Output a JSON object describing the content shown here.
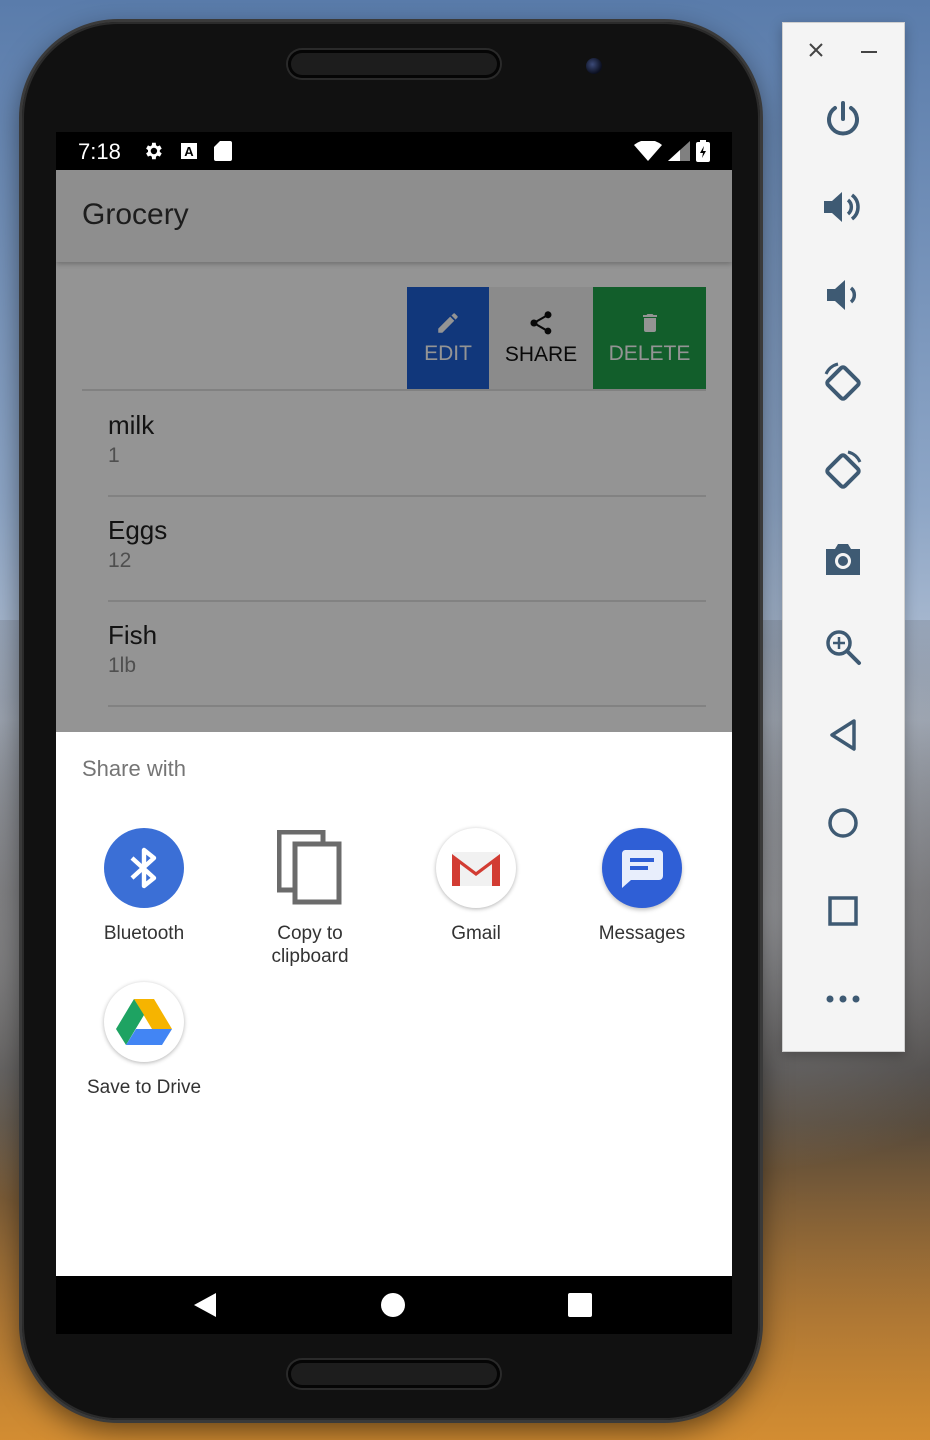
{
  "status_bar": {
    "time": "7:18"
  },
  "app": {
    "title": "Grocery",
    "swipe_actions": {
      "edit": "EDIT",
      "share": "SHARE",
      "delete": "DELETE"
    },
    "items": [
      {
        "name": "milk",
        "qty": "1"
      },
      {
        "name": "Eggs",
        "qty": "12"
      },
      {
        "name": "Fish",
        "qty": "1lb"
      }
    ]
  },
  "share_sheet": {
    "title": "Share with",
    "targets": [
      {
        "label": "Bluetooth",
        "icon": "bluetooth-icon"
      },
      {
        "label": "Copy to\nclipboard",
        "icon": "copy-icon"
      },
      {
        "label": "Gmail",
        "icon": "gmail-icon"
      },
      {
        "label": "Messages",
        "icon": "messages-icon"
      },
      {
        "label": "Save to Drive",
        "icon": "drive-icon"
      }
    ]
  },
  "emulator_controls": [
    "power-icon",
    "volume-up-icon",
    "volume-down-icon",
    "rotate-left-icon",
    "rotate-right-icon",
    "camera-icon",
    "zoom-icon",
    "back-icon",
    "home-icon",
    "overview-icon",
    "more-icon"
  ],
  "colors": {
    "edit": "#1e5fd4",
    "delete": "#1fa24a",
    "bluetooth": "#3b6fd6",
    "messages": "#2f5fd6"
  }
}
